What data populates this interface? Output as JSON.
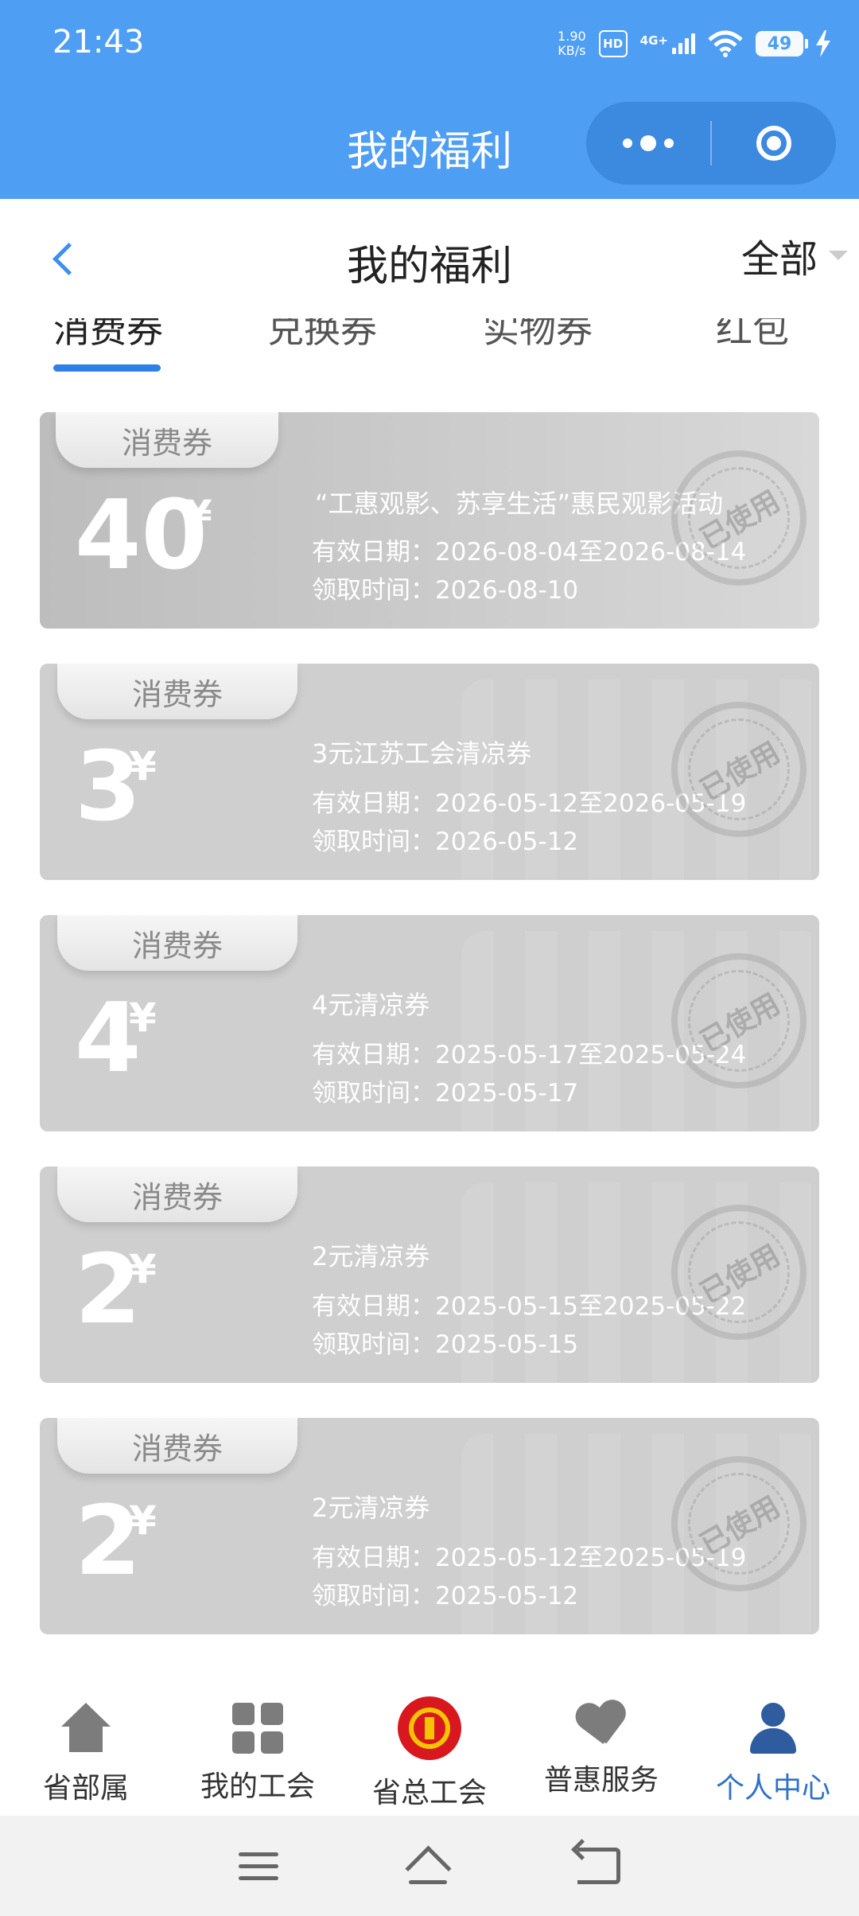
{
  "status_bar": {
    "time": "21:43",
    "net_speed_value": "1.90",
    "net_speed_unit": "KB/s",
    "hd_label": "HD",
    "network_label": "4G+",
    "battery_level": "49"
  },
  "mini_program": {
    "title": "我的福利"
  },
  "header": {
    "title": "我的福利",
    "filter_label": "全部"
  },
  "tabs": [
    {
      "label": "消费券",
      "active": true
    },
    {
      "label": "兑换券",
      "active": false
    },
    {
      "label": "实物券",
      "active": false
    },
    {
      "label": "红包",
      "active": false
    }
  ],
  "coupons": [
    {
      "tag": "消费券",
      "amount": "40",
      "currency": "¥",
      "title": "“工惠观影、苏享生活”惠民观影活动",
      "valid": "有效日期：2026-08-04至2026-08-14",
      "received": "领取时间：2026-08-10",
      "stamp": "已使用"
    },
    {
      "tag": "消费券",
      "amount": "3",
      "currency": "¥",
      "title": "3元江苏工会清凉券",
      "valid": "有效日期：2026-05-12至2026-05-19",
      "received": "领取时间：2026-05-12",
      "stamp": "已使用"
    },
    {
      "tag": "消费券",
      "amount": "4",
      "currency": "¥",
      "title": "4元清凉券",
      "valid": "有效日期：2025-05-17至2025-05-24",
      "received": "领取时间：2025-05-17",
      "stamp": "已使用"
    },
    {
      "tag": "消费券",
      "amount": "2",
      "currency": "¥",
      "title": "2元清凉券",
      "valid": "有效日期：2025-05-15至2025-05-22",
      "received": "领取时间：2025-05-15",
      "stamp": "已使用"
    },
    {
      "tag": "消费券",
      "amount": "2",
      "currency": "¥",
      "title": "2元清凉券",
      "valid": "有效日期：2025-05-12至2025-05-19",
      "received": "领取时间：2025-05-12",
      "stamp": "已使用"
    }
  ],
  "bottom_nav": [
    {
      "label": "省部属",
      "icon": "home-icon"
    },
    {
      "label": "我的工会",
      "icon": "grid-icon"
    },
    {
      "label": "省总工会",
      "icon": "union-emblem-icon"
    },
    {
      "label": "普惠服务",
      "icon": "heart-icon"
    },
    {
      "label": "个人中心",
      "icon": "user-icon",
      "active": true
    }
  ],
  "colors": {
    "brand_blue": "#4e9ef4",
    "tab_active": "#2e7fe6",
    "nav_active": "#2e72c7",
    "card_gray": "#cfcfcf"
  }
}
